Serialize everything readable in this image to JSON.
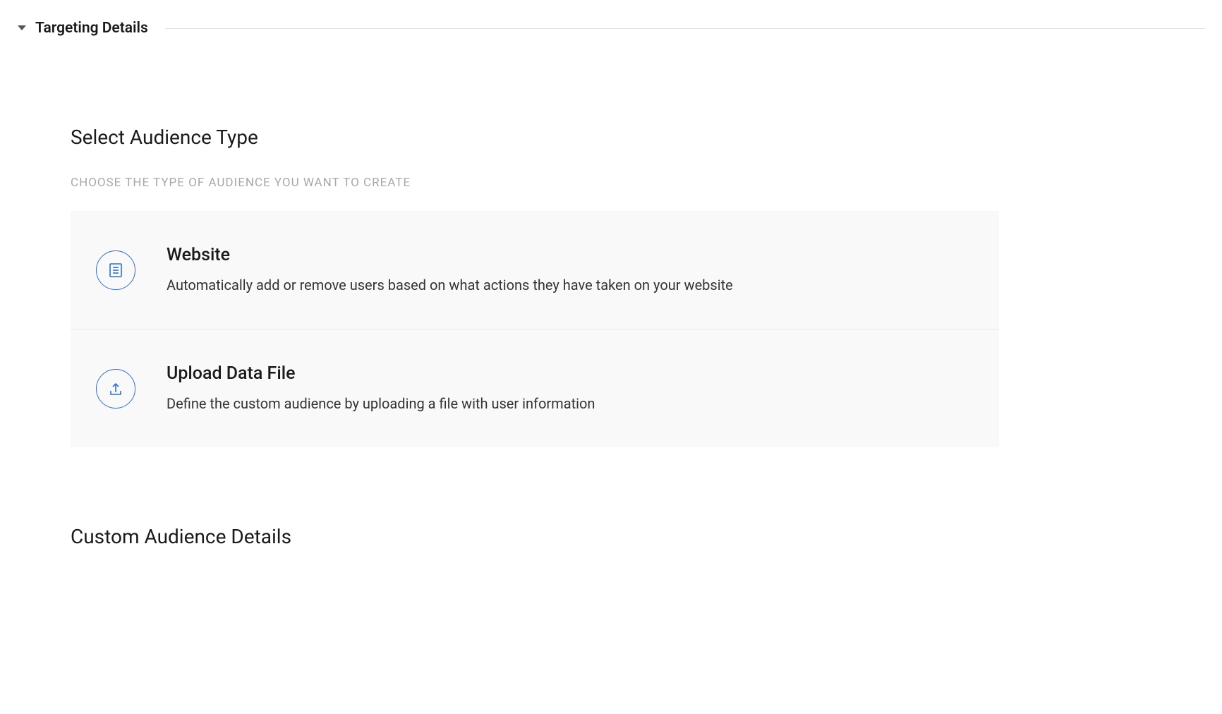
{
  "section": {
    "title": "Targeting Details"
  },
  "audience": {
    "heading": "Select Audience Type",
    "sub_label": "CHOOSE THE TYPE OF AUDIENCE YOU WANT TO CREATE",
    "options": [
      {
        "title": "Website",
        "description": "Automatically add or remove users based on what actions they have taken on your website",
        "icon": "document-icon"
      },
      {
        "title": "Upload Data File",
        "description": "Define the custom audience by uploading a file with user information",
        "icon": "upload-icon"
      }
    ]
  },
  "custom_audience": {
    "heading": "Custom Audience Details"
  },
  "colors": {
    "accent": "#2d6fd8",
    "text_primary": "#1a1a1a",
    "text_secondary": "#333333",
    "text_muted": "#a8a8a8",
    "card_bg": "#f9f9fa",
    "divider": "#e6e6e6"
  }
}
